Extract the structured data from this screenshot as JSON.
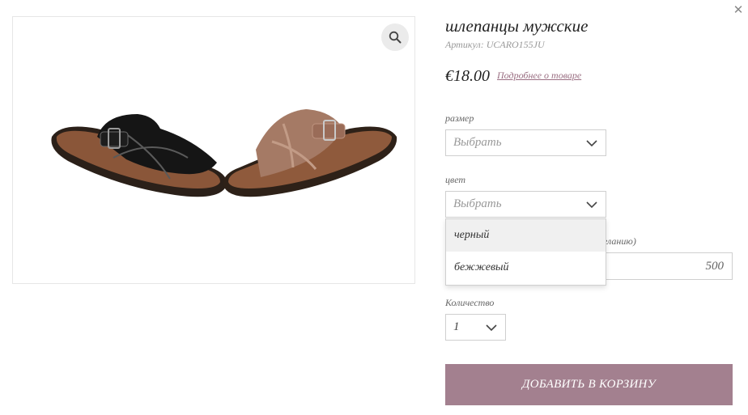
{
  "product": {
    "title": "шлепанцы мужские",
    "sku_label": "Артикул:",
    "sku": "UCARO155JU",
    "price": "€18.00",
    "details_link": "Подробнее о товаре"
  },
  "options": {
    "size": {
      "label": "размер",
      "placeholder": "Выбрать"
    },
    "color": {
      "label": "цвет",
      "placeholder": "Выбрать",
      "items": [
        "черный",
        "бежжевый"
      ],
      "highlighted": "черный"
    },
    "gift": {
      "label_partial": "желанию)",
      "value": "500"
    },
    "quantity": {
      "label": "Количество",
      "value": "1"
    }
  },
  "actions": {
    "add_to_cart": "ДОБАВИТЬ В КОРЗИНУ"
  },
  "icons": {
    "close": "close-icon",
    "zoom": "magnifier-icon",
    "chevron": "chevron-down-icon"
  },
  "colors": {
    "button": "#a3808f",
    "link": "#9a6e82"
  }
}
